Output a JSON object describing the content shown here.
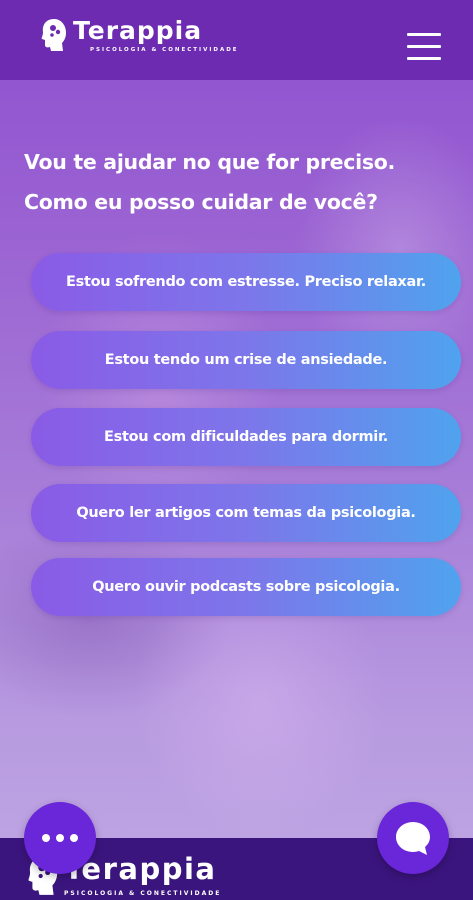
{
  "header": {
    "brand": "Terappia",
    "tagline": "PSICOLOGIA & CONECTIVIDADE",
    "menu_icon": "hamburger-menu-icon"
  },
  "hero": {
    "line1": "Vou te ajudar no que for preciso.",
    "line2": "Como eu posso cuidar de você?"
  },
  "options": [
    {
      "label": "Estou sofrendo com estresse. Preciso relaxar."
    },
    {
      "label": "Estou tendo um crise de ansiedade."
    },
    {
      "label": "Estou com dificuldades para dormir."
    },
    {
      "label": "Quero ler artigos com temas da psicologia."
    },
    {
      "label": "Quero ouvir podcasts sobre psicologia."
    }
  ],
  "footer": {
    "brand": "Terappia",
    "tagline": "PSICOLOGIA & CONECTIVIDADE"
  },
  "fabs": {
    "left_icon": "more-dots-icon",
    "right_icon": "chat-bubble-icon"
  },
  "colors": {
    "header": "#6c2bb0",
    "footer": "#3b157e",
    "button_start": "#8a5be6",
    "button_end": "#4fa3ee",
    "fab": "#6a26d9"
  }
}
